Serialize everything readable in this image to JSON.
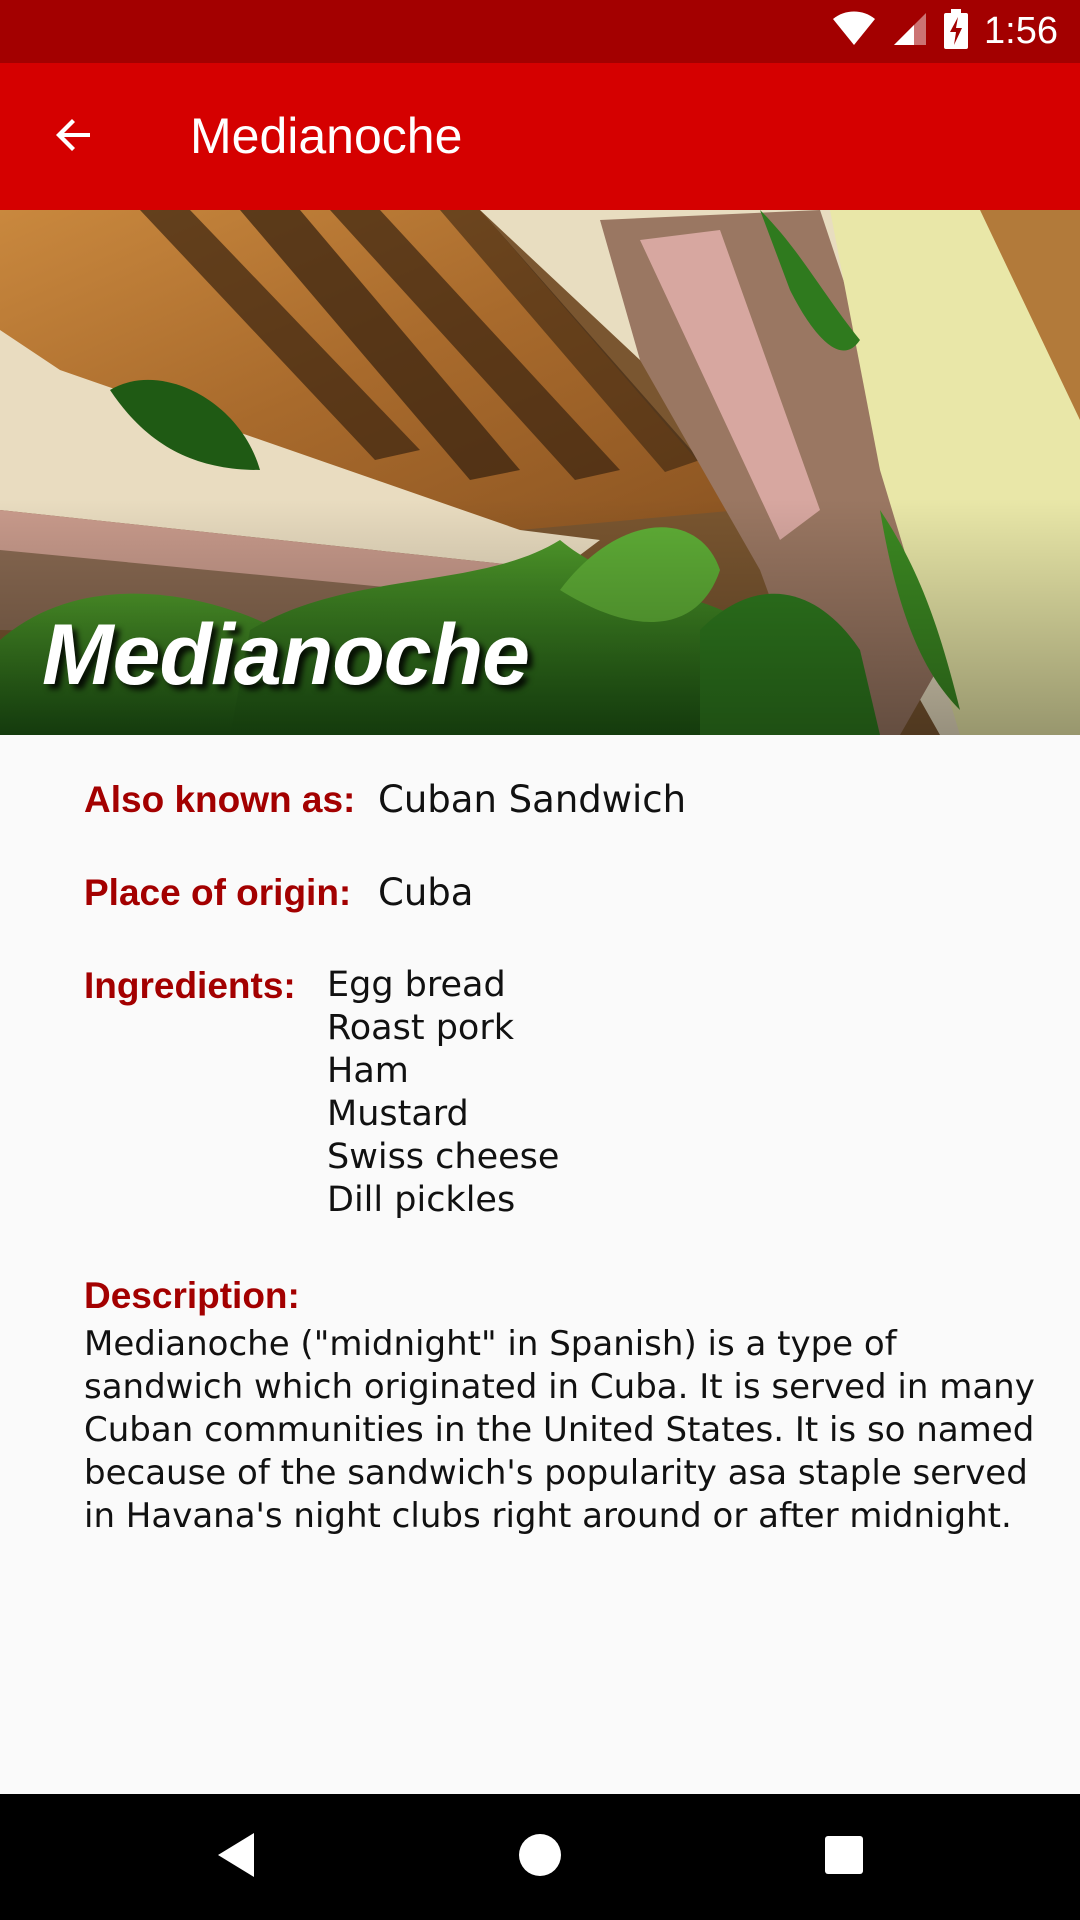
{
  "status_bar": {
    "time": "1:56",
    "icons": [
      "wifi-icon",
      "signal-icon",
      "battery-charging-icon"
    ],
    "background": "#a30000"
  },
  "app_bar": {
    "title": "Medianoche",
    "back_icon": "arrow-back-icon",
    "background": "#d50000"
  },
  "hero": {
    "title": "Medianoche",
    "image_alt": "Cuban sandwich photo"
  },
  "details": {
    "also_known_as": {
      "label": "Also known as:",
      "value": "Cuban Sandwich"
    },
    "place_of_origin": {
      "label": "Place of origin:",
      "value": "Cuba"
    },
    "ingredients": {
      "label": "Ingredients:",
      "items": [
        "Egg bread",
        "Roast pork",
        "Ham",
        "Mustard",
        "Swiss cheese",
        "Dill pickles"
      ]
    },
    "description": {
      "label": "Description:",
      "text": "Medianoche (\"midnight\" in Spanish) is a type of sandwich which originated in Cuba. It is served in many Cuban communities in the United States. It is so named because of the sandwich's popularity asa staple served in Havana's night clubs right around or after midnight."
    }
  },
  "nav_bar": {
    "icons": [
      "back-triangle-icon",
      "home-circle-icon",
      "recents-square-icon"
    ]
  },
  "colors": {
    "accent": "#d50000",
    "label": "#a30000",
    "background": "#fafafa"
  }
}
